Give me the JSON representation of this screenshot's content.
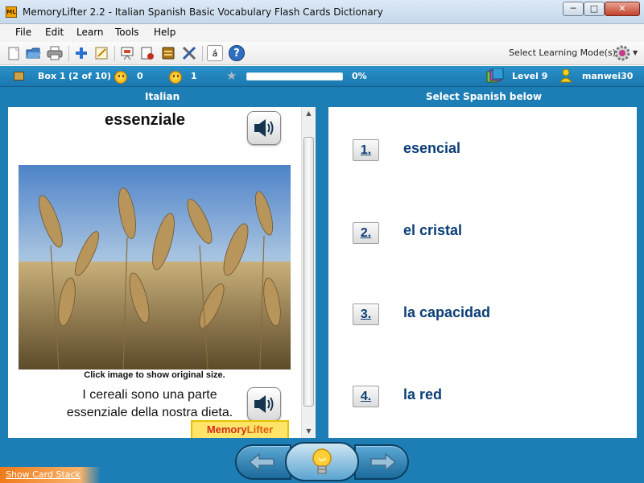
{
  "window": {
    "icon_text": "ML",
    "title": "MemoryLifter 2.2 - Italian Spanish Basic Vocabulary Flash Cards Dictionary",
    "min_label": "─",
    "max_label": "□",
    "close_label": "✕"
  },
  "menu": [
    "File",
    "Edit",
    "Learn",
    "Tools",
    "Help"
  ],
  "toolbar": {
    "icons": [
      "new-file-icon",
      "open-folder-icon",
      "print-icon",
      "add-card-icon",
      "edit-card-icon",
      "slideshow-icon",
      "statistics-icon",
      "dictionary-icon",
      "tools-icon",
      "special-characters-icon",
      "help-icon"
    ],
    "special_char_label": "á",
    "help_label": "?",
    "learning_mode_label": "Select Learning Mode(s)"
  },
  "status": {
    "box_label": "Box 1",
    "box_position": "(2 of 10)",
    "correct_count": "0",
    "wrong_count": "1",
    "progress_percent": 0,
    "progress_label": "0%",
    "level_label": "Level 9",
    "username": "manwei30"
  },
  "question": {
    "header": "Italian",
    "word": "essenziale",
    "image_caption": "Click image to show original size.",
    "example_sentence": "I cereali sono una parte essenziale della nostra dieta.",
    "logo_text_a": "Memory",
    "logo_text_b": "Lifter"
  },
  "answers": {
    "header": "Select Spanish below",
    "options": [
      {
        "number": "1.",
        "text": "esencial"
      },
      {
        "number": "2.",
        "text": "el cristal"
      },
      {
        "number": "3.",
        "text": "la capacidad"
      },
      {
        "number": "4.",
        "text": "la red"
      }
    ]
  },
  "footer": {
    "show_card_stack": "Show Card Stack"
  },
  "colors": {
    "main_blue": "#1d7eb6",
    "answer_text": "#0b3e77",
    "accent_orange": "#f07a1a"
  }
}
